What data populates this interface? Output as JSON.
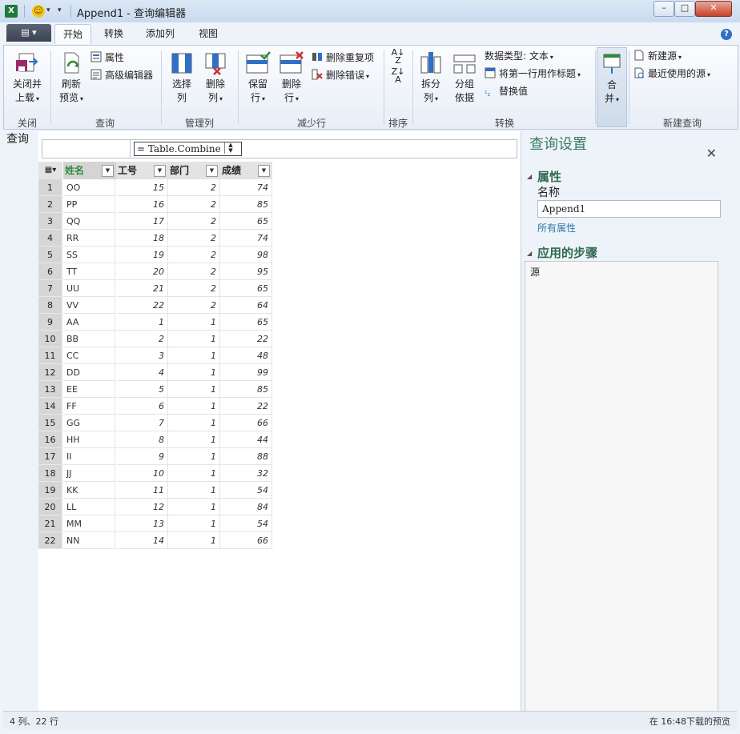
{
  "window": {
    "title": "Append1 - 查询编辑器",
    "file_button": "▤ ▾"
  },
  "ribbon": {
    "tabs": [
      "开始",
      "转换",
      "添加列",
      "视图"
    ],
    "groups": {
      "close": {
        "label": "关闭",
        "close_load": "关闭并",
        "close_load2": "上载"
      },
      "query": {
        "label": "查询",
        "refresh": "刷新",
        "refresh2": "预览",
        "properties": "属性",
        "advanced_editor": "高级编辑器"
      },
      "manage_cols": {
        "label": "管理列",
        "choose_cols": "选择",
        "choose_cols2": "列",
        "remove_cols": "删除",
        "remove_cols2": "列"
      },
      "reduce_rows": {
        "label": "减少行",
        "keep_rows": "保留",
        "keep_rows2": "行",
        "remove_rows": "删除",
        "remove_rows2": "行",
        "remove_duplicates": "删除重复项",
        "remove_errors": "删除错误"
      },
      "sort": {
        "label": "排序"
      },
      "transform": {
        "label": "转换",
        "split_col": "拆分",
        "split_col2": "列",
        "group_by": "分组",
        "group_by2": "依据",
        "data_type": "数据类型: 文本",
        "first_row_header": "将第一行用作标题",
        "replace_values": "替换值"
      },
      "combine": {
        "merge": "合",
        "merge2": "并"
      },
      "new_query": {
        "label": "新建查询",
        "new_source": "新建源",
        "recent_sources": "最近使用的源"
      }
    }
  },
  "query_pane": {
    "label": "查询"
  },
  "formula": {
    "text": "= Table.Combine"
  },
  "grid": {
    "columns": [
      "姓名",
      "工号",
      "部门",
      "成绩"
    ],
    "rows": [
      [
        "OO",
        "15",
        "2",
        "74"
      ],
      [
        "PP",
        "16",
        "2",
        "85"
      ],
      [
        "QQ",
        "17",
        "2",
        "65"
      ],
      [
        "RR",
        "18",
        "2",
        "74"
      ],
      [
        "SS",
        "19",
        "2",
        "98"
      ],
      [
        "TT",
        "20",
        "2",
        "95"
      ],
      [
        "UU",
        "21",
        "2",
        "65"
      ],
      [
        "VV",
        "22",
        "2",
        "64"
      ],
      [
        "AA",
        "1",
        "1",
        "65"
      ],
      [
        "BB",
        "2",
        "1",
        "22"
      ],
      [
        "CC",
        "3",
        "1",
        "48"
      ],
      [
        "DD",
        "4",
        "1",
        "99"
      ],
      [
        "EE",
        "5",
        "1",
        "85"
      ],
      [
        "FF",
        "6",
        "1",
        "22"
      ],
      [
        "GG",
        "7",
        "1",
        "66"
      ],
      [
        "HH",
        "8",
        "1",
        "44"
      ],
      [
        "II",
        "9",
        "1",
        "88"
      ],
      [
        "JJ",
        "10",
        "1",
        "32"
      ],
      [
        "KK",
        "11",
        "1",
        "54"
      ],
      [
        "LL",
        "12",
        "1",
        "84"
      ],
      [
        "MM",
        "13",
        "1",
        "54"
      ],
      [
        "NN",
        "14",
        "1",
        "66"
      ]
    ]
  },
  "settings": {
    "title": "查询设置",
    "properties_title": "属性",
    "name_label": "名称",
    "name_value": "Append1",
    "all_properties": "所有属性",
    "steps_title": "应用的步骤",
    "steps": [
      "源"
    ]
  },
  "status": {
    "left": "4 列、22 行",
    "right": "在 16:48下载的预览"
  }
}
